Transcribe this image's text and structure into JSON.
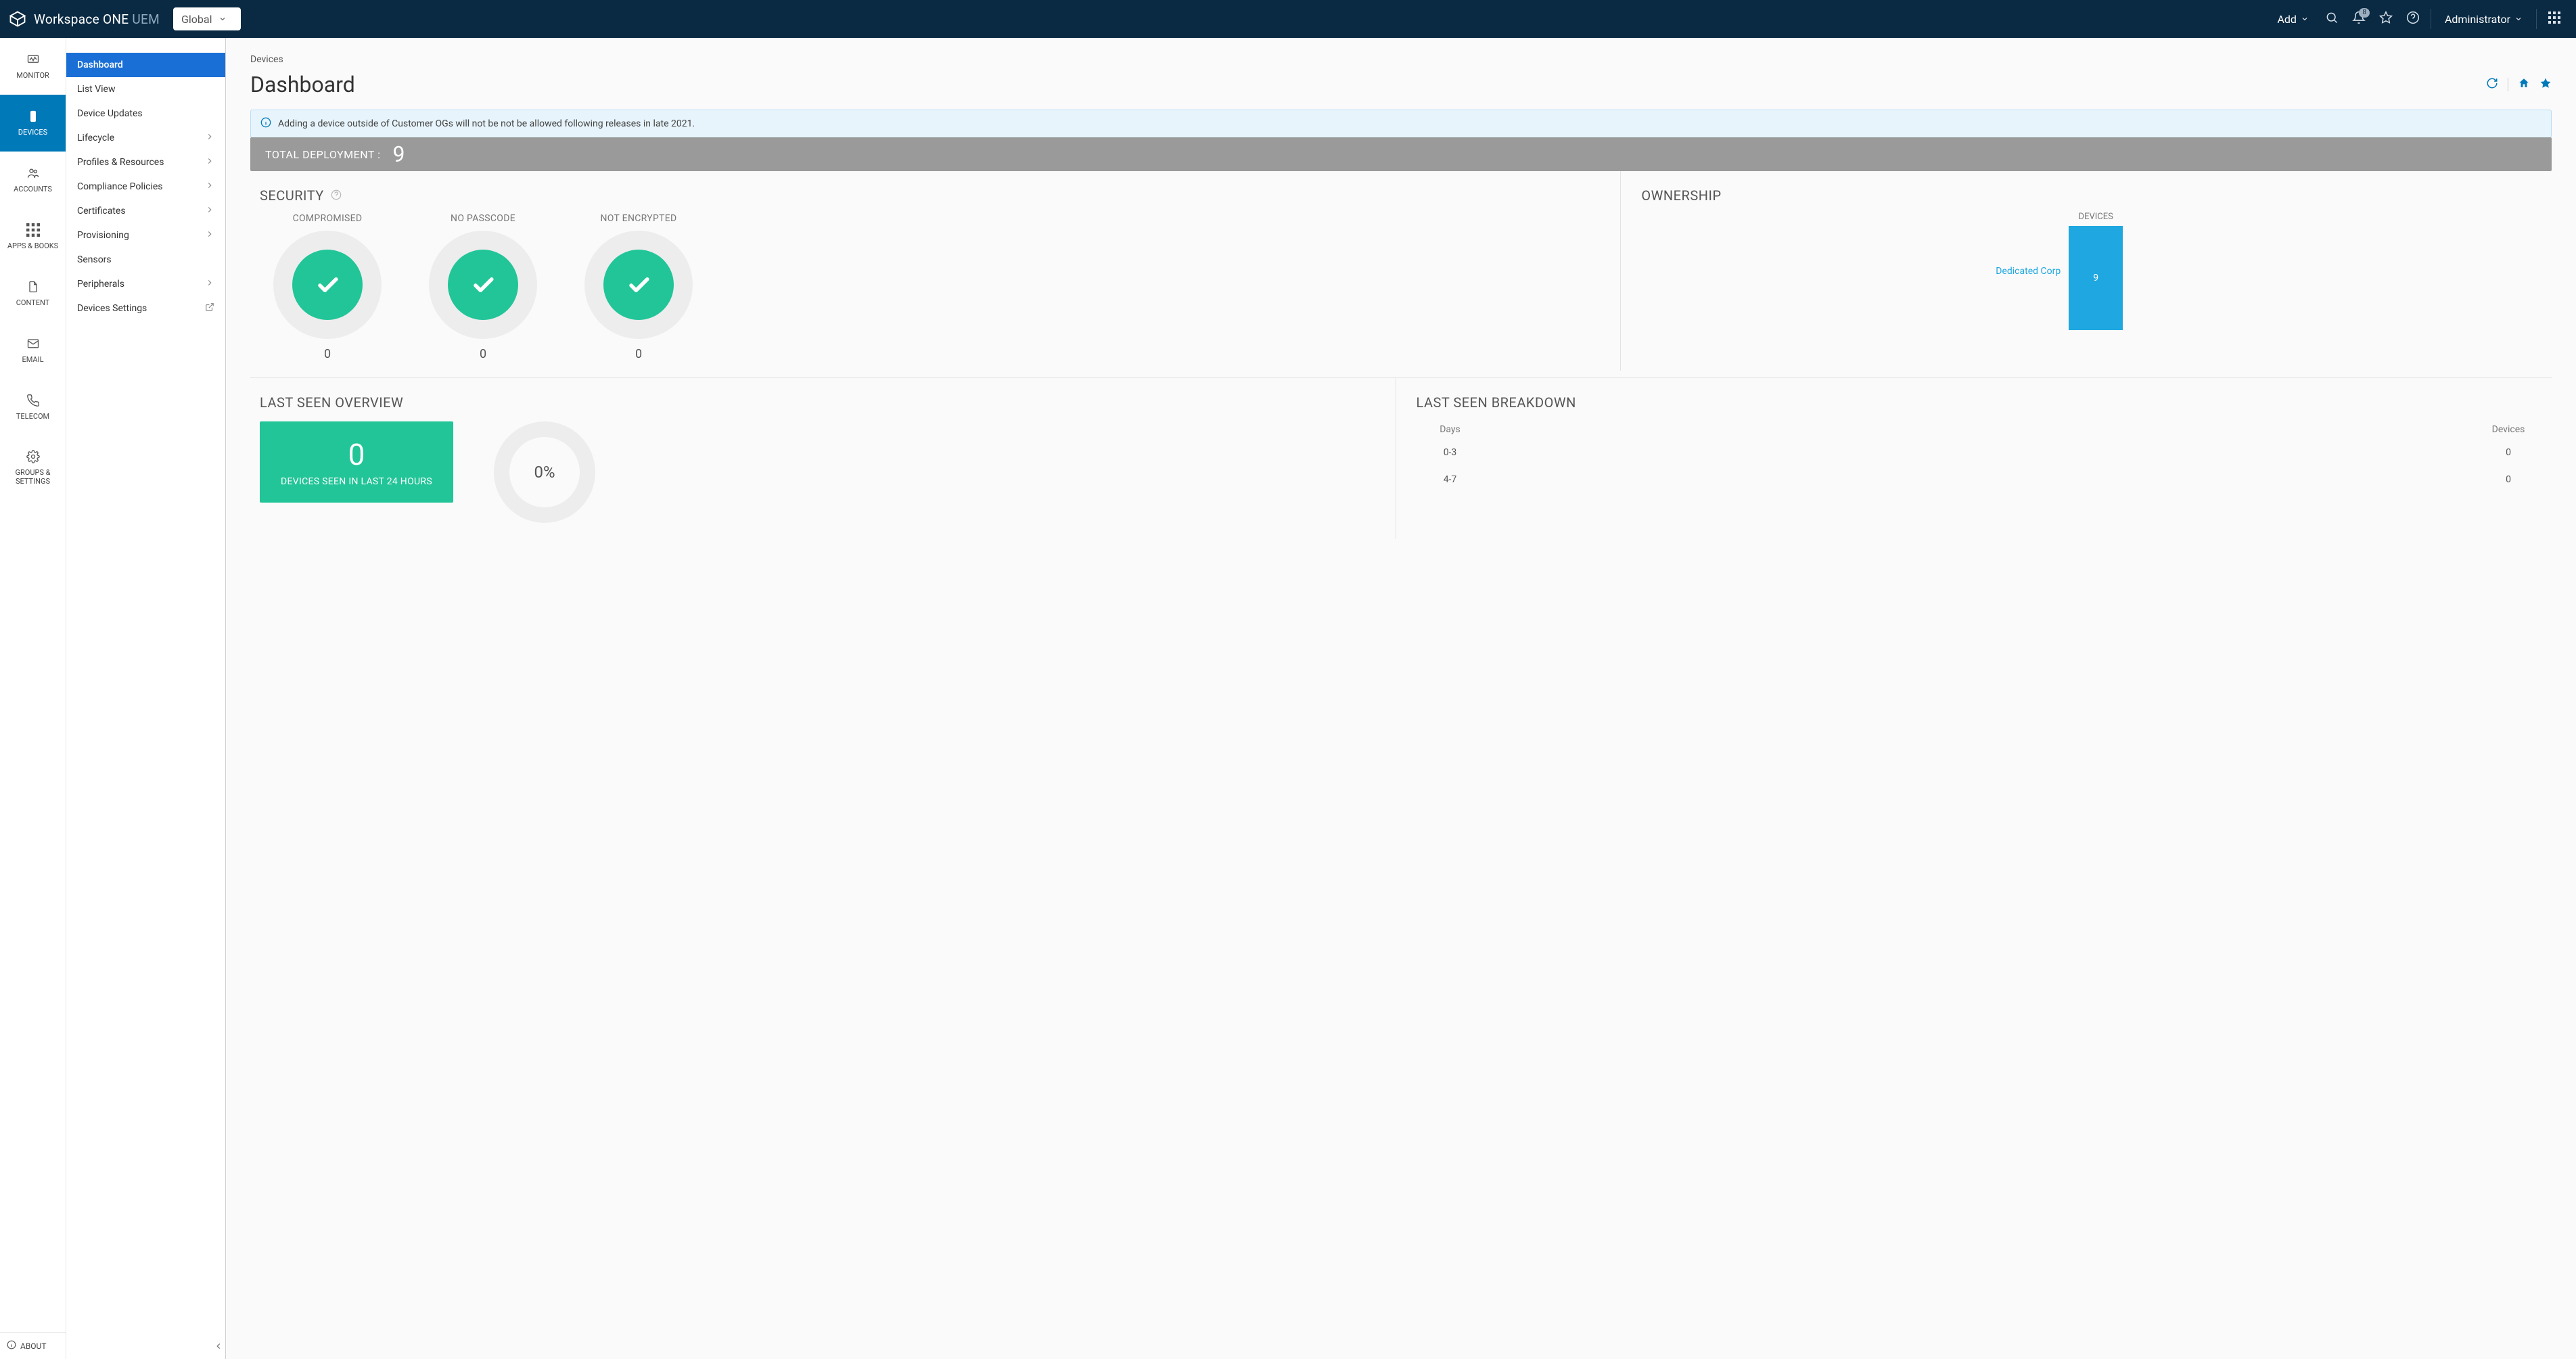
{
  "brand": {
    "name": "Workspace ONE",
    "suffix": "UEM"
  },
  "og_selector": {
    "label": "Global"
  },
  "topbar": {
    "add_label": "Add",
    "notification_count": "8",
    "user_label": "Administrator"
  },
  "rail": {
    "items": [
      {
        "id": "monitor",
        "label": "MONITOR"
      },
      {
        "id": "devices",
        "label": "DEVICES",
        "active": true
      },
      {
        "id": "accounts",
        "label": "ACCOUNTS"
      },
      {
        "id": "apps",
        "label": "APPS & BOOKS"
      },
      {
        "id": "content",
        "label": "CONTENT"
      },
      {
        "id": "email",
        "label": "EMAIL"
      },
      {
        "id": "telecom",
        "label": "TELECOM"
      },
      {
        "id": "groups",
        "label": "GROUPS & SETTINGS"
      }
    ],
    "about": "ABOUT"
  },
  "subnav": {
    "items": [
      {
        "label": "Dashboard",
        "active": true
      },
      {
        "label": "List View"
      },
      {
        "label": "Device Updates"
      },
      {
        "label": "Lifecycle",
        "expandable": true
      },
      {
        "label": "Profiles & Resources",
        "expandable": true
      },
      {
        "label": "Compliance Policies",
        "expandable": true
      },
      {
        "label": "Certificates",
        "expandable": true
      },
      {
        "label": "Provisioning",
        "expandable": true
      },
      {
        "label": "Sensors"
      },
      {
        "label": "Peripherals",
        "expandable": true
      },
      {
        "label": "Devices Settings",
        "external": true
      }
    ]
  },
  "page": {
    "breadcrumb": "Devices",
    "title": "Dashboard",
    "banner": "Adding a device outside of Customer OGs will not be not be allowed following releases in late 2021.",
    "deploy_label": "TOTAL DEPLOYMENT :",
    "deploy_value": "9"
  },
  "security": {
    "title": "SECURITY",
    "cards": [
      {
        "label": "COMPROMISED",
        "count": "0"
      },
      {
        "label": "NO PASSCODE",
        "count": "0"
      },
      {
        "label": "NOT ENCRYPTED",
        "count": "0"
      }
    ]
  },
  "ownership": {
    "title": "OWNERSHIP",
    "axis_title": "DEVICES",
    "category_label": "Dedicated Corp",
    "bar_value": "9"
  },
  "last_seen_overview": {
    "title": "LAST SEEN OVERVIEW",
    "big_value": "0",
    "big_sub": "DEVICES SEEN IN LAST 24 HOURS",
    "donut_value": "0%"
  },
  "last_seen_breakdown": {
    "title": "LAST SEEN BREAKDOWN",
    "col_days": "Days",
    "col_devices": "Devices",
    "rows": [
      {
        "range": "0-3",
        "devices": "0"
      },
      {
        "range": "4-7",
        "devices": "0"
      }
    ]
  },
  "chart_data": [
    {
      "type": "bar",
      "title": "OWNERSHIP — DEVICES",
      "categories": [
        "Dedicated Corp"
      ],
      "values": [
        9
      ],
      "ylabel": "Devices"
    },
    {
      "type": "pie",
      "title": "SECURITY",
      "series": [
        {
          "name": "COMPROMISED",
          "values": [
            0
          ]
        },
        {
          "name": "NO PASSCODE",
          "values": [
            0
          ]
        },
        {
          "name": "NOT ENCRYPTED",
          "values": [
            0
          ]
        }
      ]
    },
    {
      "type": "pie",
      "title": "LAST SEEN OVERVIEW",
      "values": [
        0
      ],
      "annotations": [
        "0%",
        "0 DEVICES SEEN IN LAST 24 HOURS"
      ]
    },
    {
      "type": "table",
      "title": "LAST SEEN BREAKDOWN",
      "columns": [
        "Days",
        "Devices"
      ],
      "rows": [
        [
          "0-3",
          0
        ],
        [
          "4-7",
          0
        ]
      ]
    }
  ]
}
